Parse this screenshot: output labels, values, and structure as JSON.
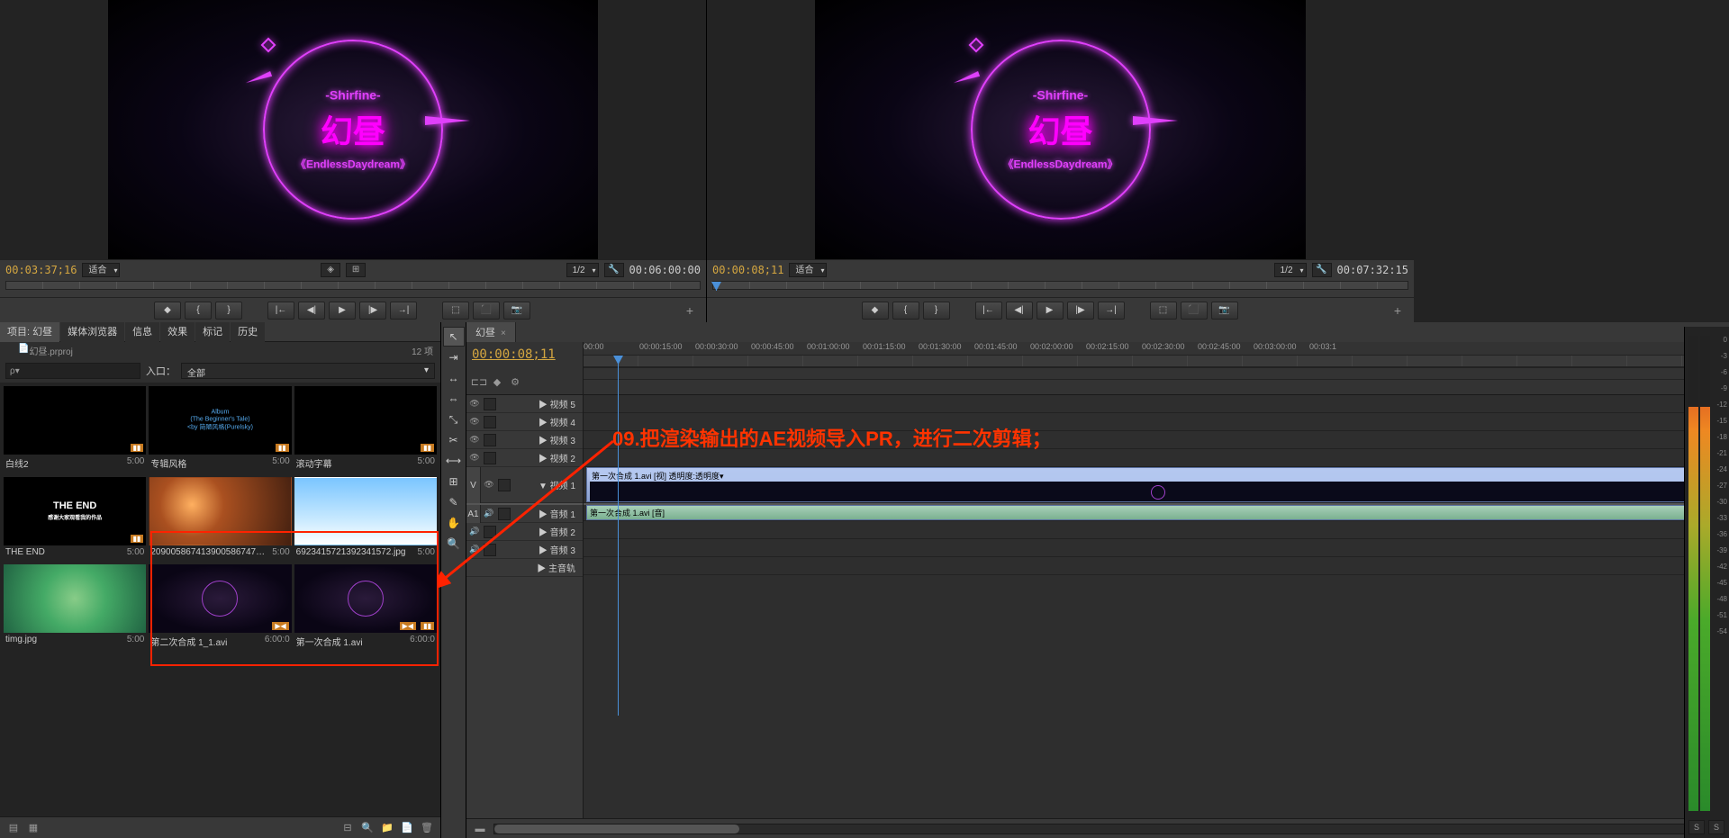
{
  "monitors": {
    "left": {
      "timecode": "00:03:37;16",
      "fit_label": "适合",
      "half_label": "1/2",
      "duration": "00:06:00:00",
      "preview_text_top": "-Shirfine-",
      "preview_text_mid": "幻昼",
      "preview_text_bot": "《EndlessDaydream》"
    },
    "right": {
      "timecode": "00:00:08;11",
      "fit_label": "适合",
      "half_label": "1/2",
      "duration": "00:07:32:15",
      "preview_text_top": "-Shirfine-",
      "preview_text_mid": "幻昼",
      "preview_text_bot": "《EndlessDaydream》"
    }
  },
  "project": {
    "tabs": [
      "项目: 幻昼",
      "媒体浏览器",
      "信息",
      "效果",
      "标记",
      "历史"
    ],
    "active_tab": 0,
    "filename": "幻昼.prproj",
    "item_count": "12 项",
    "search_placeholder": "",
    "entry_label": "入口：",
    "entry_value": "全部",
    "items": [
      {
        "name": "白线2",
        "duration": "5:00",
        "thumb": "black-lines"
      },
      {
        "name": "专辑风格",
        "duration": "5:00",
        "thumb": "album-text"
      },
      {
        "name": "滚动字幕",
        "duration": "5:00",
        "thumb": "black"
      },
      {
        "name": "THE END",
        "duration": "5:00",
        "thumb": "the-end"
      },
      {
        "name": "2090058674139005867474.jpg",
        "duration": "5:00",
        "thumb": "lights"
      },
      {
        "name": "6923415721392341572.jpg",
        "duration": "5:00",
        "thumb": "sky"
      },
      {
        "name": "timg.jpg",
        "duration": "5:00",
        "thumb": "green"
      },
      {
        "name": "第二次合成 1_1.avi",
        "duration": "6:00:0",
        "thumb": "space"
      },
      {
        "name": "第一次合成 1.avi",
        "duration": "6:00:0",
        "thumb": "space"
      }
    ]
  },
  "timeline": {
    "tab_name": "幻昼",
    "timecode": "00:00:08;11",
    "ruler_ticks": [
      "00:00",
      "00:00:15:00",
      "00:00:30:00",
      "00:00:45:00",
      "00:01:00:00",
      "00:01:15:00",
      "00:01:30:00",
      "00:01:45:00",
      "00:02:00:00",
      "00:02:15:00",
      "00:02:30:00",
      "00:02:45:00",
      "00:03:00:00",
      "00:03:1"
    ],
    "video_tracks": [
      {
        "name": "▶ 视频 5"
      },
      {
        "name": "▶ 视频 4"
      },
      {
        "name": "▶ 视频 3"
      },
      {
        "name": "▶ 视频 2"
      },
      {
        "name": "▼ 视频 1"
      }
    ],
    "audio_tracks": [
      {
        "name": "▶ 音频 1"
      },
      {
        "name": "▶ 音频 2"
      },
      {
        "name": "▶ 音频 3"
      },
      {
        "name": "▶ 主音轨"
      }
    ],
    "video_clip_label": "第一次合成 1.avi [视] 透明度:透明度▾",
    "audio_clip_label": "第一次合成 1.avi [音]",
    "v_label": "V",
    "a_label": "A1"
  },
  "annotation": {
    "text": "09.把渲染输出的AE视频导入PR，进行二次剪辑；"
  },
  "meter_ticks": [
    "0",
    "-3",
    "-6",
    "-9",
    "-12",
    "-15",
    "-18",
    "-21",
    "-24",
    "-27",
    "-30",
    "-33",
    "-36",
    "-39",
    "-42",
    "-45",
    "-48",
    "-51",
    "-54"
  ],
  "meter_s": "S"
}
